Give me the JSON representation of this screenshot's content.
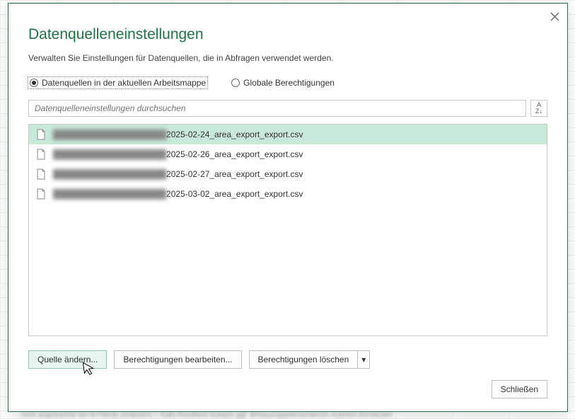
{
  "dialog": {
    "title": "Datenquelleneinstellungen",
    "subtitle": "Verwalten Sie Einstellungen für Datenquellen, die in Abfragen verwendet werden."
  },
  "radios": {
    "current": "Datenquellen in der aktuellen Arbeitsmappe",
    "global": "Globale Berechtigungen"
  },
  "search": {
    "placeholder": "Datenquelleneinstellungen durchsuchen"
  },
  "files": [
    {
      "prefix": "████████████████████",
      "name": "2025-02-24_area_export_export.csv",
      "selected": true
    },
    {
      "prefix": "████████████████████",
      "name": "2025-02-26_area_export_export.csv",
      "selected": false
    },
    {
      "prefix": "████████████████████",
      "name": "2025-02-27_area_export_export.csv",
      "selected": false
    },
    {
      "prefix": "████████████████████",
      "name": "2025-03-02_area_export_export.csv",
      "selected": false
    }
  ],
  "buttons": {
    "change_source": "Quelle ändern...",
    "edit_permissions": "Berechtigungen bearbeiten...",
    "clear_permissions": "Berechtigungen löschen",
    "close": "Schließen"
  },
  "sort_label": "A↓Z",
  "bg_text": "nicht angrenzend  Set-B-Fläche (realisiert) + Kaifu-Nordland  Gutacht        ggf. Bebauungsplanverfahren einleiten  Eimsbüttel"
}
